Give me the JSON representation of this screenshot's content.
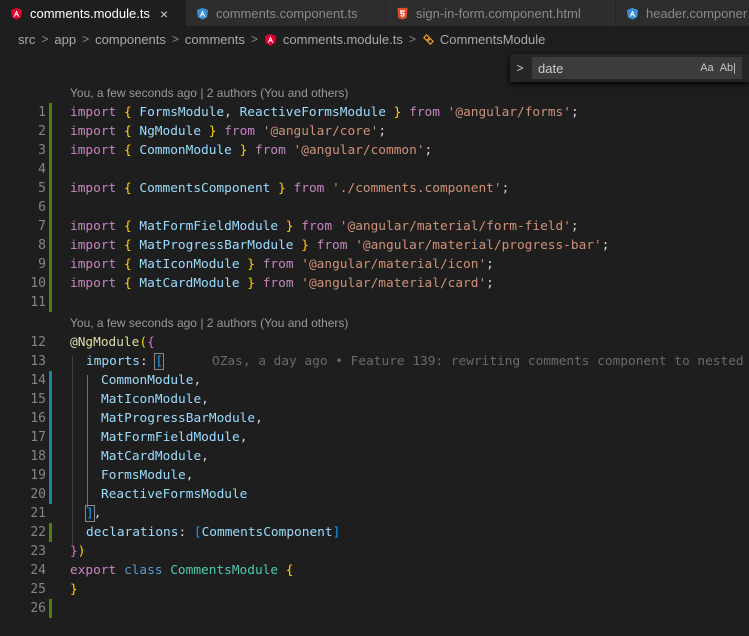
{
  "tabs": [
    {
      "label": "comments.module.ts",
      "icon": "angular-icon",
      "active": true,
      "close": "×"
    },
    {
      "label": "comments.component.ts",
      "icon": "typescript-icon",
      "active": false
    },
    {
      "label": "sign-in-form.component.html",
      "icon": "html5-icon",
      "active": false
    },
    {
      "label": "header.componer",
      "icon": "typescript-icon",
      "active": false
    }
  ],
  "breadcrumb": {
    "items": [
      "src",
      "app",
      "components",
      "comments",
      "comments.module.ts",
      "CommentsModule"
    ],
    "separator": ">"
  },
  "find": {
    "toggle": ">",
    "value": "date",
    "match_case": "Aa",
    "whole_word": "Ab|"
  },
  "codelens": [
    "You, a few seconds ago | 2 authors (You and others)",
    "You, a few seconds ago | 2 authors (You and others)"
  ],
  "blame": "OZas, a day ago • Feature 139: rewriting comments component to nested",
  "lines": [
    {
      "n": "1",
      "text": "import { FormsModule, ReactiveFormsModule } from '@angular/forms';",
      "change": "added"
    },
    {
      "n": "2",
      "text": "import { NgModule } from '@angular/core';",
      "change": "added"
    },
    {
      "n": "3",
      "text": "import { CommonModule } from '@angular/common';",
      "change": "added"
    },
    {
      "n": "4",
      "text": "",
      "change": "added"
    },
    {
      "n": "5",
      "text": "import { CommentsComponent } from './comments.component';",
      "change": "added"
    },
    {
      "n": "6",
      "text": "",
      "change": "added"
    },
    {
      "n": "7",
      "text": "import { MatFormFieldModule } from '@angular/material/form-field';",
      "change": "added"
    },
    {
      "n": "8",
      "text": "import { MatProgressBarModule } from '@angular/material/progress-bar';",
      "change": "added"
    },
    {
      "n": "9",
      "text": "import { MatIconModule } from '@angular/material/icon';",
      "change": "added"
    },
    {
      "n": "10",
      "text": "import { MatCardModule } from '@angular/material/card';",
      "change": "added"
    },
    {
      "n": "11",
      "text": "",
      "change": "added"
    },
    {
      "n": "12",
      "text": "@NgModule({",
      "change": "none"
    },
    {
      "n": "13",
      "text": "imports: [",
      "change": "none"
    },
    {
      "n": "14",
      "text": "CommonModule,",
      "change": "modified"
    },
    {
      "n": "15",
      "text": "MatIconModule,",
      "change": "modified"
    },
    {
      "n": "16",
      "text": "MatProgressBarModule,",
      "change": "modified"
    },
    {
      "n": "17",
      "text": "MatFormFieldModule,",
      "change": "modified"
    },
    {
      "n": "18",
      "text": "MatCardModule,",
      "change": "modified"
    },
    {
      "n": "19",
      "text": "FormsModule,",
      "change": "modified"
    },
    {
      "n": "20",
      "text": "ReactiveFormsModule",
      "change": "modified"
    },
    {
      "n": "21",
      "text": "],",
      "change": "none"
    },
    {
      "n": "22",
      "text": "declarations: [CommentsComponent]",
      "change": "added"
    },
    {
      "n": "23",
      "text": "})",
      "change": "none"
    },
    {
      "n": "24",
      "text": "export class CommentsModule {",
      "change": "none"
    },
    {
      "n": "25",
      "text": "}",
      "change": "none"
    },
    {
      "n": "26",
      "text": "",
      "change": "added"
    }
  ],
  "colors": {
    "editor_bg": "#1e1e1e",
    "gutter_added": "#587c0c",
    "gutter_modified": "#1b81a8",
    "keyword": "#c586c0",
    "string": "#ce9178",
    "class": "#4ec9b0"
  }
}
